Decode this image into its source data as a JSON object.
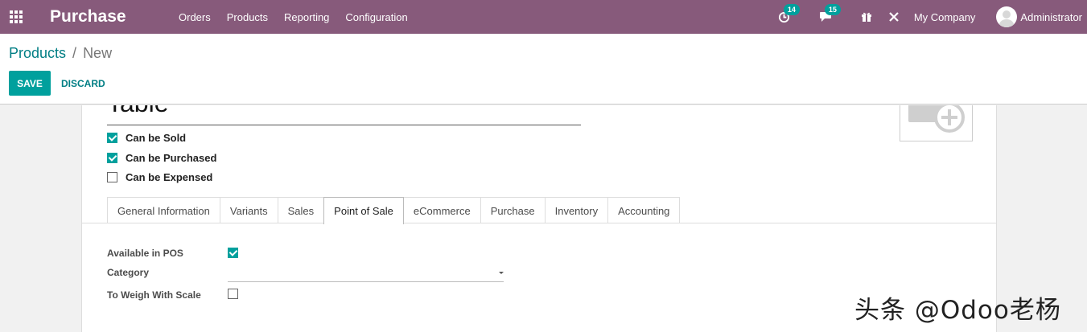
{
  "navbar": {
    "app_title": "Purchase",
    "menu": [
      "Orders",
      "Products",
      "Reporting",
      "Configuration"
    ],
    "activity_count": "14",
    "messages_count": "15",
    "company": "My Company",
    "user": "Administrator",
    "bg_color": "#875a7b",
    "icons": [
      "apps-grid-icon",
      "activity-clock-icon",
      "chat-icon",
      "gift-icon",
      "debug-tools-icon",
      "user-avatar-icon"
    ]
  },
  "breadcrumb": {
    "parent": "Products",
    "separator": "/",
    "current": "New"
  },
  "buttons": {
    "save": "SAVE",
    "discard": "DISCARD"
  },
  "form": {
    "product_name": "Table",
    "options": [
      {
        "label": "Can be Sold",
        "checked": true
      },
      {
        "label": "Can be Purchased",
        "checked": true
      },
      {
        "label": "Can be Expensed",
        "checked": false
      }
    ],
    "tabs": [
      "General Information",
      "Variants",
      "Sales",
      "Point of Sale",
      "eCommerce",
      "Purchase",
      "Inventory",
      "Accounting"
    ],
    "active_tab": "Point of Sale",
    "pos": {
      "available_label": "Available in POS",
      "available_checked": true,
      "category_label": "Category",
      "category_value": "",
      "weigh_label": "To Weigh With Scale",
      "weigh_checked": false
    }
  },
  "accent_color": "#00a09d",
  "link_color": "#017e84",
  "watermark": "头条 @Odoo老杨"
}
